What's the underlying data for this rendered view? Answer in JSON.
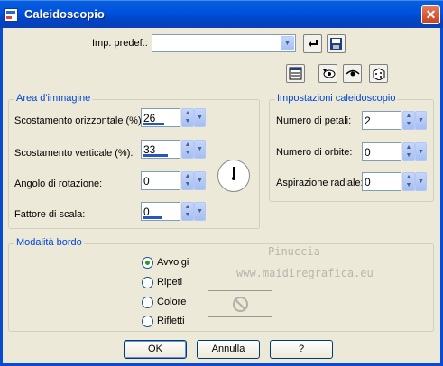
{
  "window": {
    "title": "Caleidoscopio",
    "close_glyph": "✕"
  },
  "preset": {
    "label": "Imp. predef.:",
    "value": ""
  },
  "area": {
    "title": "Area d'immagine",
    "fields": [
      {
        "label": "Scostamento orizzontale (%):",
        "value": "26",
        "level_pct": 58
      },
      {
        "label": "Scostamento verticale (%):",
        "value": "33",
        "level_pct": 66
      },
      {
        "label": "Angolo di rotazione:",
        "value": "0",
        "level_pct": 0
      },
      {
        "label": "Fattore di scala:",
        "value": "0",
        "level_pct": 50
      }
    ]
  },
  "settings": {
    "title": "Impostazioni caleidoscopio",
    "fields": [
      {
        "label": "Numero di petali:",
        "value": "2"
      },
      {
        "label": "Numero di orbite:",
        "value": "0"
      },
      {
        "label": "Aspirazione radiale:",
        "value": "0"
      }
    ]
  },
  "border_mode": {
    "title": "Modalità bordo",
    "options": [
      {
        "label": "Avvolgi",
        "selected": true
      },
      {
        "label": "Ripeti",
        "selected": false
      },
      {
        "label": "Colore",
        "selected": false
      },
      {
        "label": "Rifletti",
        "selected": false
      }
    ]
  },
  "watermark": {
    "line1": "Pinuccia",
    "line2": "www.maidiregrafica.eu"
  },
  "buttons": {
    "ok": "OK",
    "cancel": "Annulla",
    "help": "?"
  },
  "colors": {
    "titlebar": "#0053e1",
    "accent_text": "#0046d5",
    "dialog_bg": "#ece9d8"
  },
  "icons": [
    "close-icon",
    "load-preset-icon",
    "save-preset-icon",
    "preview-toggle-icon",
    "show-original-icon",
    "show-preview-icon",
    "randomize-icon",
    "no-color-icon"
  ]
}
